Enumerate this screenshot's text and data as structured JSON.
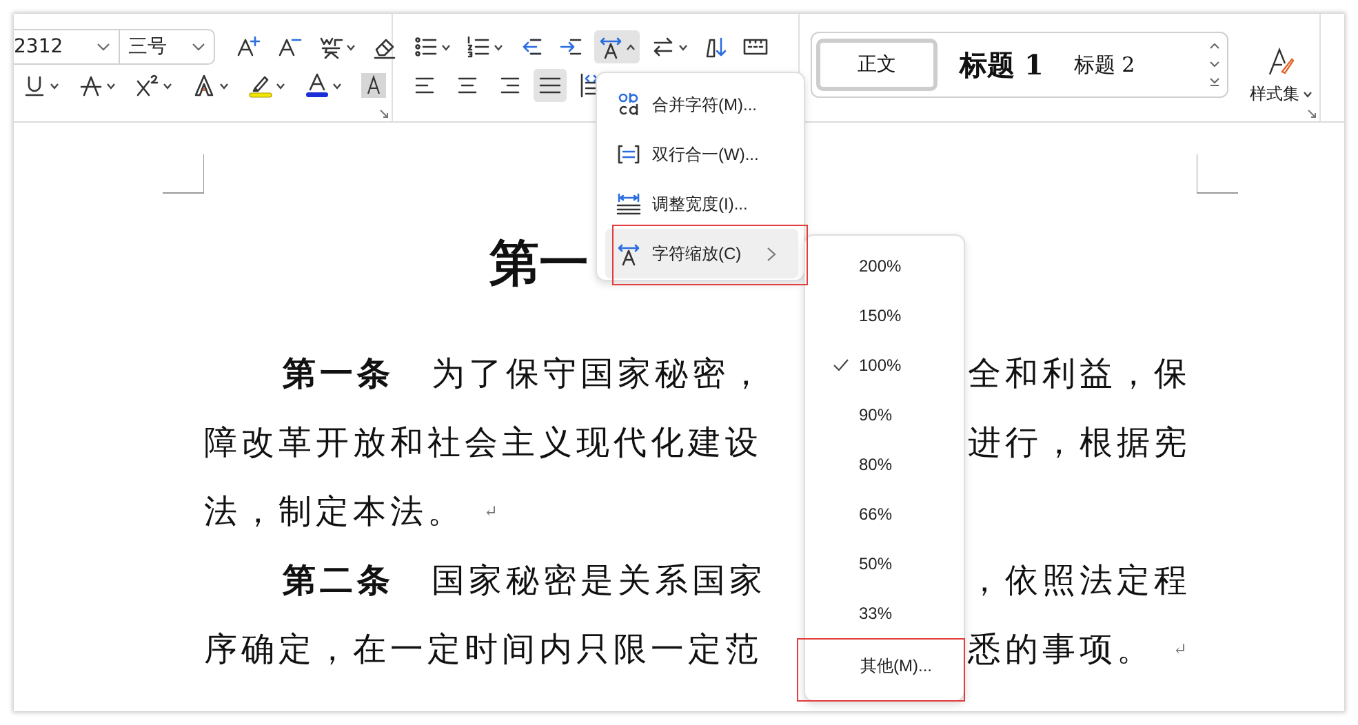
{
  "toolbar": {
    "font_name": "2312",
    "font_size": "三号",
    "font_row_1": [
      {
        "kind": "grow",
        "has_menu": false,
        "active": false
      },
      {
        "kind": "shrink",
        "has_menu": false,
        "active": false
      },
      {
        "kind": "phonetic",
        "has_menu": true,
        "active": false
      },
      {
        "kind": "clear",
        "has_menu": false,
        "active": false
      }
    ],
    "font_row_2": [
      {
        "kind": "underline",
        "has_menu": true,
        "active": false
      },
      {
        "kind": "strike",
        "has_menu": true,
        "active": false
      },
      {
        "kind": "superscript",
        "has_menu": true,
        "active": false
      },
      {
        "kind": "effect",
        "has_menu": true,
        "active": false
      },
      {
        "kind": "highlight",
        "has_menu": true,
        "active": false
      },
      {
        "kind": "color",
        "has_menu": true,
        "active": false
      },
      {
        "kind": "shade",
        "has_menu": false,
        "active": false
      }
    ],
    "para_row_1": [
      {
        "kind": "bullets",
        "has_menu": true,
        "active": false
      },
      {
        "kind": "numbers",
        "has_menu": true,
        "active": false
      },
      {
        "kind": "outdent",
        "has_menu": false,
        "active": false
      },
      {
        "kind": "indent",
        "has_menu": false,
        "active": false
      },
      {
        "kind": "scale",
        "has_menu": true,
        "menu_open": true,
        "active": true
      },
      {
        "kind": "direction",
        "has_menu": true,
        "active": false
      },
      {
        "kind": "sort",
        "has_menu": false,
        "active": false
      },
      {
        "kind": "border",
        "has_menu": false,
        "active": false
      }
    ],
    "para_row_2": [
      {
        "kind": "left",
        "active": false
      },
      {
        "kind": "center",
        "active": false
      },
      {
        "kind": "right",
        "active": false
      },
      {
        "kind": "justify",
        "active": true
      },
      {
        "kind": "distribute",
        "active": false
      }
    ],
    "styles": [
      {
        "label": "正文",
        "kind": "body",
        "selected": true
      },
      {
        "label": "标题 1",
        "kind": "h1",
        "selected": false
      },
      {
        "label": "标题 2",
        "kind": "h2",
        "selected": false
      }
    ],
    "style_set": "样式集"
  },
  "menu": {
    "items": [
      {
        "label": "合并字符(M)...",
        "kind": "combine",
        "highlighted": false,
        "submenu": false
      },
      {
        "label": "双行合一(W)...",
        "kind": "twolines",
        "highlighted": false,
        "submenu": false
      },
      {
        "label": "调整宽度(I)...",
        "kind": "width",
        "highlighted": false,
        "submenu": false
      },
      {
        "label": "字符缩放(C)",
        "kind": "scale",
        "highlighted": true,
        "submenu": true
      }
    ]
  },
  "submenu": {
    "items": [
      {
        "label": "200%",
        "checked": false
      },
      {
        "label": "150%",
        "checked": false
      },
      {
        "label": "100%",
        "checked": true
      },
      {
        "label": "90%",
        "checked": false
      },
      {
        "label": "80%",
        "checked": false
      },
      {
        "label": "66%",
        "checked": false
      },
      {
        "label": "50%",
        "checked": false
      },
      {
        "label": "33%",
        "checked": false
      },
      {
        "label": "其他(M)...",
        "checked": false
      }
    ]
  },
  "document": {
    "title": "第一",
    "lines": [
      {
        "indent": true,
        "left": "**第一条**　为了保守国家秘密，",
        "right": "全和利益，保"
      },
      {
        "indent": false,
        "left": "障改革开放和社会主义现代化建设",
        "right": "进行，根据宪"
      },
      {
        "indent": false,
        "left": "法，制定本法。",
        "left_end": "↵"
      },
      {
        "indent": true,
        "left": "**第二条**　国家秘密是关系国家",
        "right": "，依照法定程"
      },
      {
        "indent": false,
        "left": "序确定，在一定时间内只限一定范",
        "right": "悉的事项。",
        "right_end": "↵"
      }
    ]
  }
}
